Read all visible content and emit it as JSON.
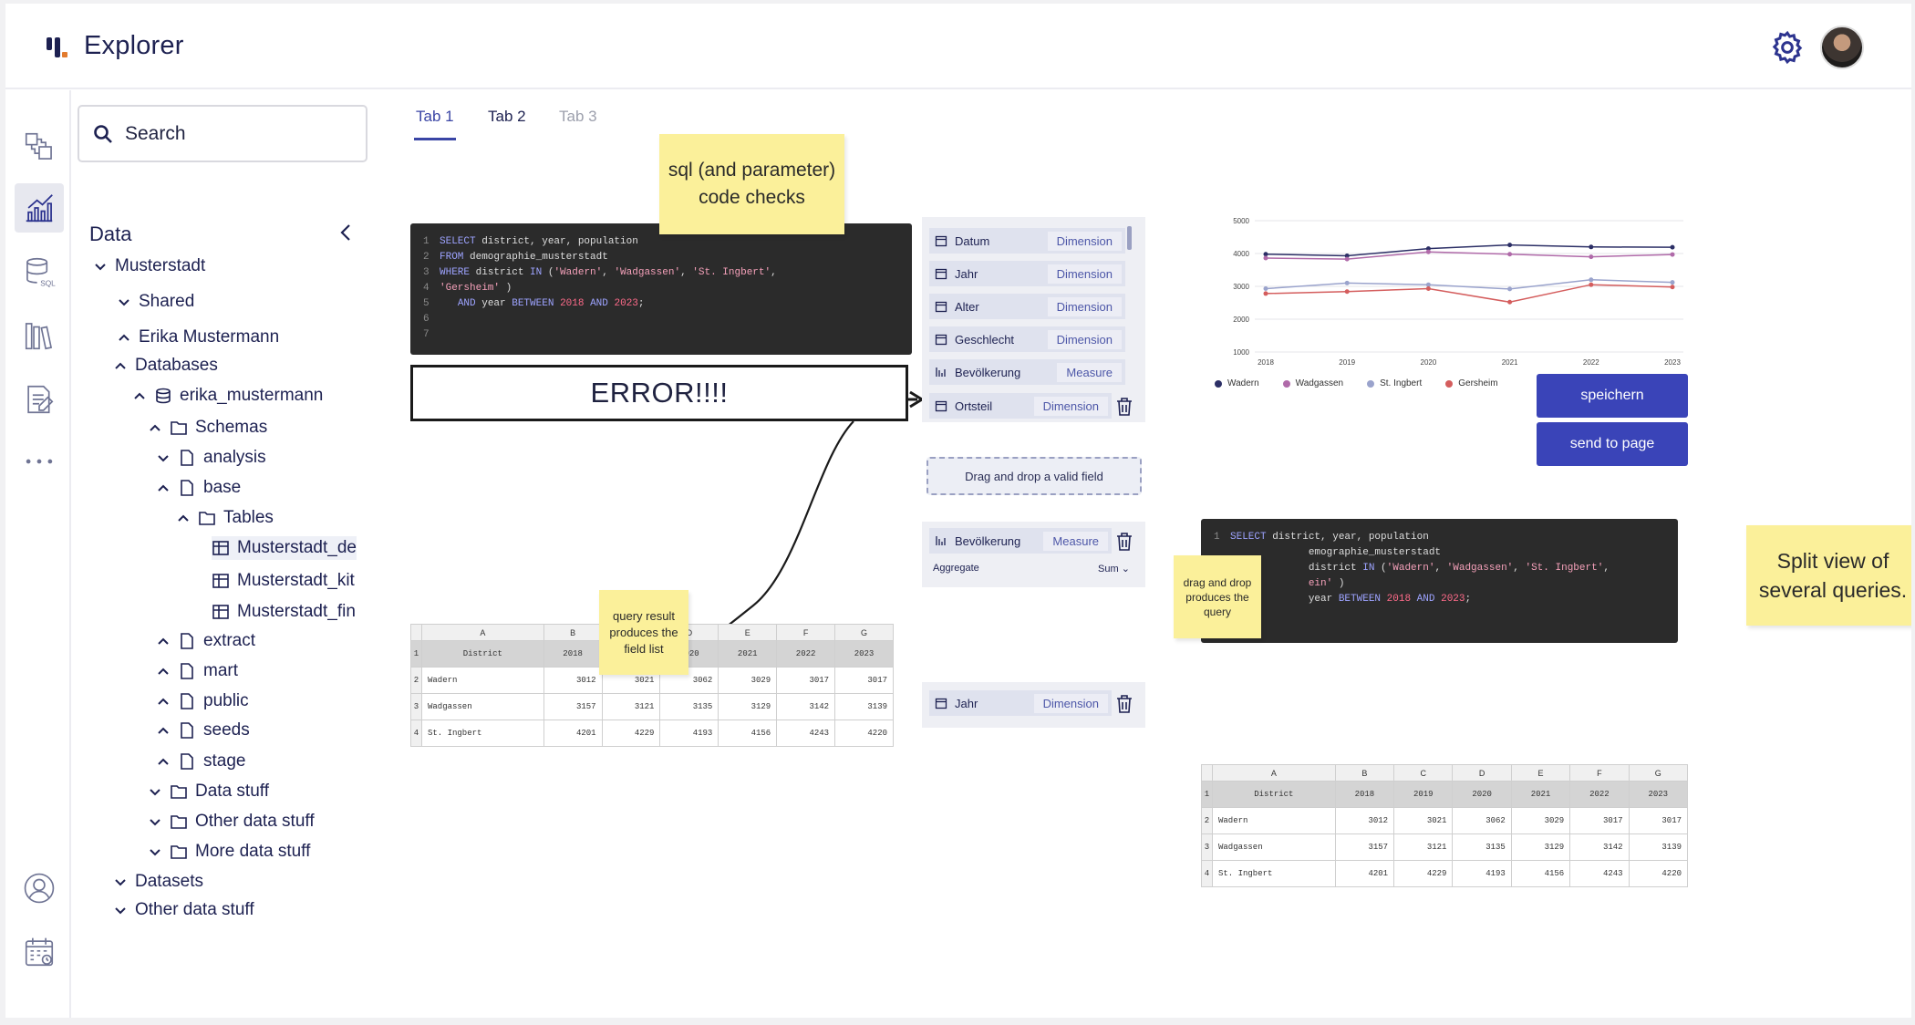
{
  "header": {
    "title": "Explorer"
  },
  "search": {
    "placeholder": "Search"
  },
  "sidebar": {
    "title": "Data",
    "tree": [
      {
        "label": "Musterstadt"
      },
      {
        "label": "Shared"
      },
      {
        "label": "Erika Mustermann"
      },
      {
        "label": "Databases"
      },
      {
        "label": "erika_mustermann"
      },
      {
        "label": "Schemas"
      },
      {
        "label": "analysis"
      },
      {
        "label": "base"
      },
      {
        "label": "Tables"
      },
      {
        "label": "Musterstadt_de"
      },
      {
        "label": "Musterstadt_kit"
      },
      {
        "label": "Musterstadt_fin"
      },
      {
        "label": "extract"
      },
      {
        "label": "mart"
      },
      {
        "label": "public"
      },
      {
        "label": "seeds"
      },
      {
        "label": "stage"
      },
      {
        "label": "Data stuff"
      },
      {
        "label": "Other data stuff"
      },
      {
        "label": "More data stuff"
      },
      {
        "label": "Datasets"
      },
      {
        "label": "Other data stuff"
      }
    ]
  },
  "tabs": [
    {
      "label": "Tab 1"
    },
    {
      "label": "Tab 2"
    },
    {
      "label": "Tab 3"
    }
  ],
  "notes": {
    "sql_checks": "sql (and parameter) code checks",
    "query_result": "query result produces the field list",
    "drag_drop": "drag and drop produces the query",
    "split_view": "Split view of several queries."
  },
  "error": {
    "text": "ERROR!!!!"
  },
  "fields": [
    {
      "name": "Datum",
      "type": "Dimension"
    },
    {
      "name": "Jahr",
      "type": "Dimension"
    },
    {
      "name": "Alter",
      "type": "Dimension"
    },
    {
      "name": "Geschlecht",
      "type": "Dimension"
    },
    {
      "name": "Bevölkerung",
      "type": "Measure"
    },
    {
      "name": "Ortsteil",
      "type": "Dimension"
    }
  ],
  "dropzone": {
    "text": "Drag and drop a valid field"
  },
  "measure": {
    "name": "Bevölkerung",
    "type": "Measure",
    "agg_label": "Aggregate",
    "agg_value": "Sum"
  },
  "jahr_field": {
    "name": "Jahr",
    "type": "Dimension"
  },
  "table": {
    "col_letters": [
      "A",
      "B",
      "C",
      "D",
      "E",
      "F",
      "G"
    ],
    "headers": [
      "District",
      "2018",
      "2019",
      "2020",
      "2021",
      "2022",
      "2023"
    ],
    "rows": [
      [
        "Wadern",
        "3012",
        "3021",
        "3062",
        "3029",
        "3017",
        "3017"
      ],
      [
        "Wadgassen",
        "3157",
        "3121",
        "3135",
        "3129",
        "3142",
        "3139"
      ],
      [
        "St. Ingbert",
        "4201",
        "4229",
        "4193",
        "4156",
        "4243",
        "4220"
      ]
    ]
  },
  "buttons": {
    "save": "speichern",
    "send": "send to page"
  },
  "chart_data": {
    "type": "line",
    "x": [
      "2018",
      "2019",
      "2020",
      "2021",
      "2022",
      "2023"
    ],
    "ylim": [
      1000,
      5000
    ],
    "yticks": [
      "5000",
      "4000",
      "3000",
      "2000",
      "1000"
    ],
    "legend_position": "bottom",
    "series": [
      {
        "name": "Wadern",
        "color": "#2c2f66",
        "values": [
          3980,
          3930,
          4150,
          4260,
          4200,
          4190
        ]
      },
      {
        "name": "Wadgassen",
        "color": "#b06aa9",
        "values": [
          3860,
          3830,
          4050,
          3980,
          3900,
          3970
        ]
      },
      {
        "name": "St. Ingbert",
        "color": "#9aa3cc",
        "values": [
          2930,
          3100,
          3050,
          2920,
          3200,
          3120
        ]
      },
      {
        "name": "Gersheim",
        "color": "#d45d5d",
        "values": [
          2780,
          2840,
          2930,
          2520,
          3050,
          2980
        ]
      }
    ]
  }
}
